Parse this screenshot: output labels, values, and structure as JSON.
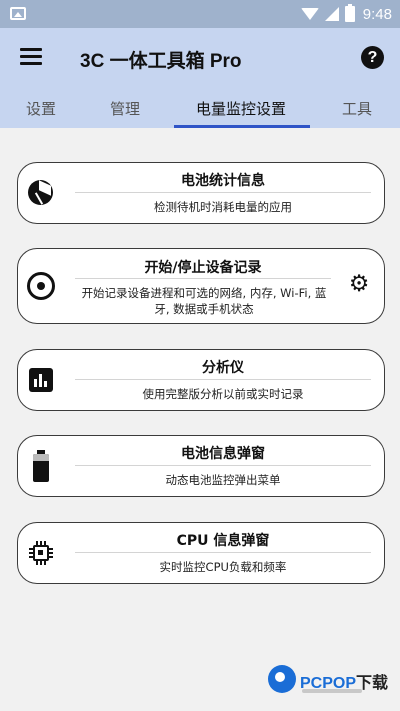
{
  "status_bar": {
    "time": "9:48"
  },
  "toolbar": {
    "title": "3C 一体工具箱 Pro"
  },
  "tabs": [
    {
      "label": "设置"
    },
    {
      "label": "管理"
    },
    {
      "label": "电量监控设置"
    },
    {
      "label": "工具"
    }
  ],
  "active_tab": "电量监控设置",
  "cards": [
    {
      "title": "电池统计信息",
      "description": "检测待机时消耗电量的应用",
      "icon": "pie-chart-icon"
    },
    {
      "title": "开始/停止设备记录",
      "description": "开始记录设备进程和可选的网络, 内存, Wi-Fi, 蓝牙, 数据或手机状态",
      "icon": "record-icon",
      "action_icon": "gear-icon"
    },
    {
      "title": "分析仪",
      "description": "使用完整版分析以前或实时记录",
      "icon": "bar-chart-icon"
    },
    {
      "title": "电池信息弹窗",
      "description": "动态电池监控弹出菜单",
      "icon": "battery-icon"
    },
    {
      "title": "CPU 信息弹窗",
      "description": "实时监控CPU负载和频率",
      "icon": "cpu-icon"
    }
  ],
  "watermark": {
    "brand": "PCPOP",
    "suffix": "下载"
  },
  "colors": {
    "toolbar": "#c6d5f0",
    "status_bar": "#9fb2cc",
    "tab_indicator": "#2f54c7",
    "watermark": "#1a6dd6"
  }
}
